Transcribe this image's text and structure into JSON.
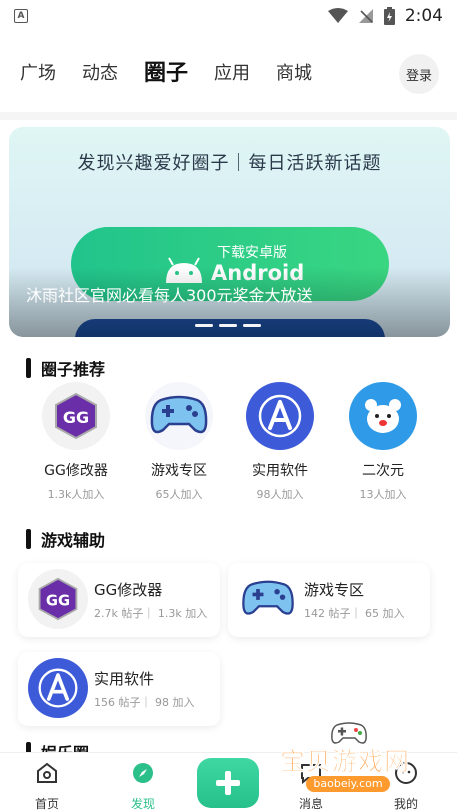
{
  "status_bar": {
    "time": "2:04",
    "app_badge": "A"
  },
  "top_nav": {
    "tabs": [
      {
        "label": "广场",
        "active": false
      },
      {
        "label": "动态",
        "active": false
      },
      {
        "label": "圈子",
        "active": true
      },
      {
        "label": "应用",
        "active": false
      },
      {
        "label": "商城",
        "active": false
      }
    ],
    "login_label": "登录"
  },
  "banner": {
    "headline": "发现兴趣爱好圈子｜每日活跃新话题",
    "button_small": "下载安卓版",
    "button_big": "Android",
    "caption": "沐雨社区官网必看每人300元奖金大放送",
    "slide_count": 3
  },
  "recommend": {
    "title": "圈子推荐",
    "items": [
      {
        "name": "GG修改器",
        "count": "1.3k人加入",
        "icon": "gg-icon"
      },
      {
        "name": "游戏专区",
        "count": "65人加入",
        "icon": "gamepad-icon"
      },
      {
        "name": "实用软件",
        "count": "98人加入",
        "icon": "app-store-icon"
      },
      {
        "name": "二次元",
        "count": "13人加入",
        "icon": "bear-icon"
      }
    ]
  },
  "game_aid": {
    "title": "游戏辅助",
    "cards": [
      {
        "name": "GG修改器",
        "stats": "2.7k 帖子｜ 1.3k 加入",
        "icon": "gg-icon"
      },
      {
        "name": "游戏专区",
        "stats": "142 帖子｜ 65 加入",
        "icon": "gamepad-icon"
      },
      {
        "name": "实用软件",
        "stats": "156 帖子｜ 98 加入",
        "icon": "app-store-icon"
      }
    ]
  },
  "next_section": {
    "title": "娱乐圈"
  },
  "bottom_nav": {
    "items": [
      {
        "label": "首页",
        "icon": "home-icon"
      },
      {
        "label": "发现",
        "icon": "compass-icon",
        "active": true
      },
      {
        "label": "消息",
        "icon": "message-icon"
      },
      {
        "label": "我的",
        "icon": "profile-icon"
      }
    ]
  },
  "watermark": {
    "text": "宝贝游戏网",
    "url": "baobeiy.com"
  },
  "colors": {
    "accent": "#2bbf8a",
    "banner_button": "#21c48c",
    "app_blue": "#3d5bd8",
    "bear_blue": "#2f9be8",
    "gg_purple": "#6a2fa8"
  }
}
